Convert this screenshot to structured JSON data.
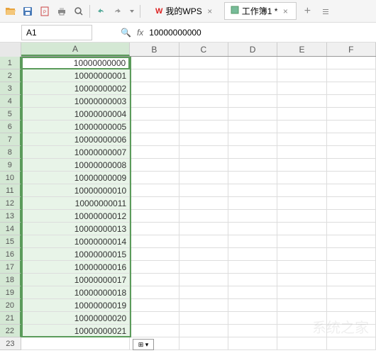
{
  "toolbar": {
    "icons": [
      "folder-open",
      "save",
      "pdf",
      "print",
      "preview",
      "undo",
      "redo"
    ]
  },
  "tabs": [
    {
      "icon": "wps",
      "label": "我的WPS",
      "active": false
    },
    {
      "icon": "sheet",
      "label": "工作簿1 *",
      "active": true
    }
  ],
  "cell_ref": "A1",
  "fx_label": "fx",
  "formula_value": "10000000000",
  "columns": [
    "A",
    "B",
    "C",
    "D",
    "E",
    "F"
  ],
  "rows": [
    {
      "n": 1,
      "A": "10000000000"
    },
    {
      "n": 2,
      "A": "10000000001"
    },
    {
      "n": 3,
      "A": "10000000002"
    },
    {
      "n": 4,
      "A": "10000000003"
    },
    {
      "n": 5,
      "A": "10000000004"
    },
    {
      "n": 6,
      "A": "10000000005"
    },
    {
      "n": 7,
      "A": "10000000006"
    },
    {
      "n": 8,
      "A": "10000000007"
    },
    {
      "n": 9,
      "A": "10000000008"
    },
    {
      "n": 10,
      "A": "10000000009"
    },
    {
      "n": 11,
      "A": "10000000010"
    },
    {
      "n": 12,
      "A": "10000000011"
    },
    {
      "n": 13,
      "A": "10000000012"
    },
    {
      "n": 14,
      "A": "10000000013"
    },
    {
      "n": 15,
      "A": "10000000014"
    },
    {
      "n": 16,
      "A": "10000000015"
    },
    {
      "n": 17,
      "A": "10000000016"
    },
    {
      "n": 18,
      "A": "10000000017"
    },
    {
      "n": 19,
      "A": "10000000018"
    },
    {
      "n": 20,
      "A": "10000000019"
    },
    {
      "n": 21,
      "A": "10000000020"
    },
    {
      "n": 22,
      "A": "10000000021"
    },
    {
      "n": 23,
      "A": ""
    }
  ],
  "smart_tag": "⊞ ▾",
  "watermark": "系统之家"
}
